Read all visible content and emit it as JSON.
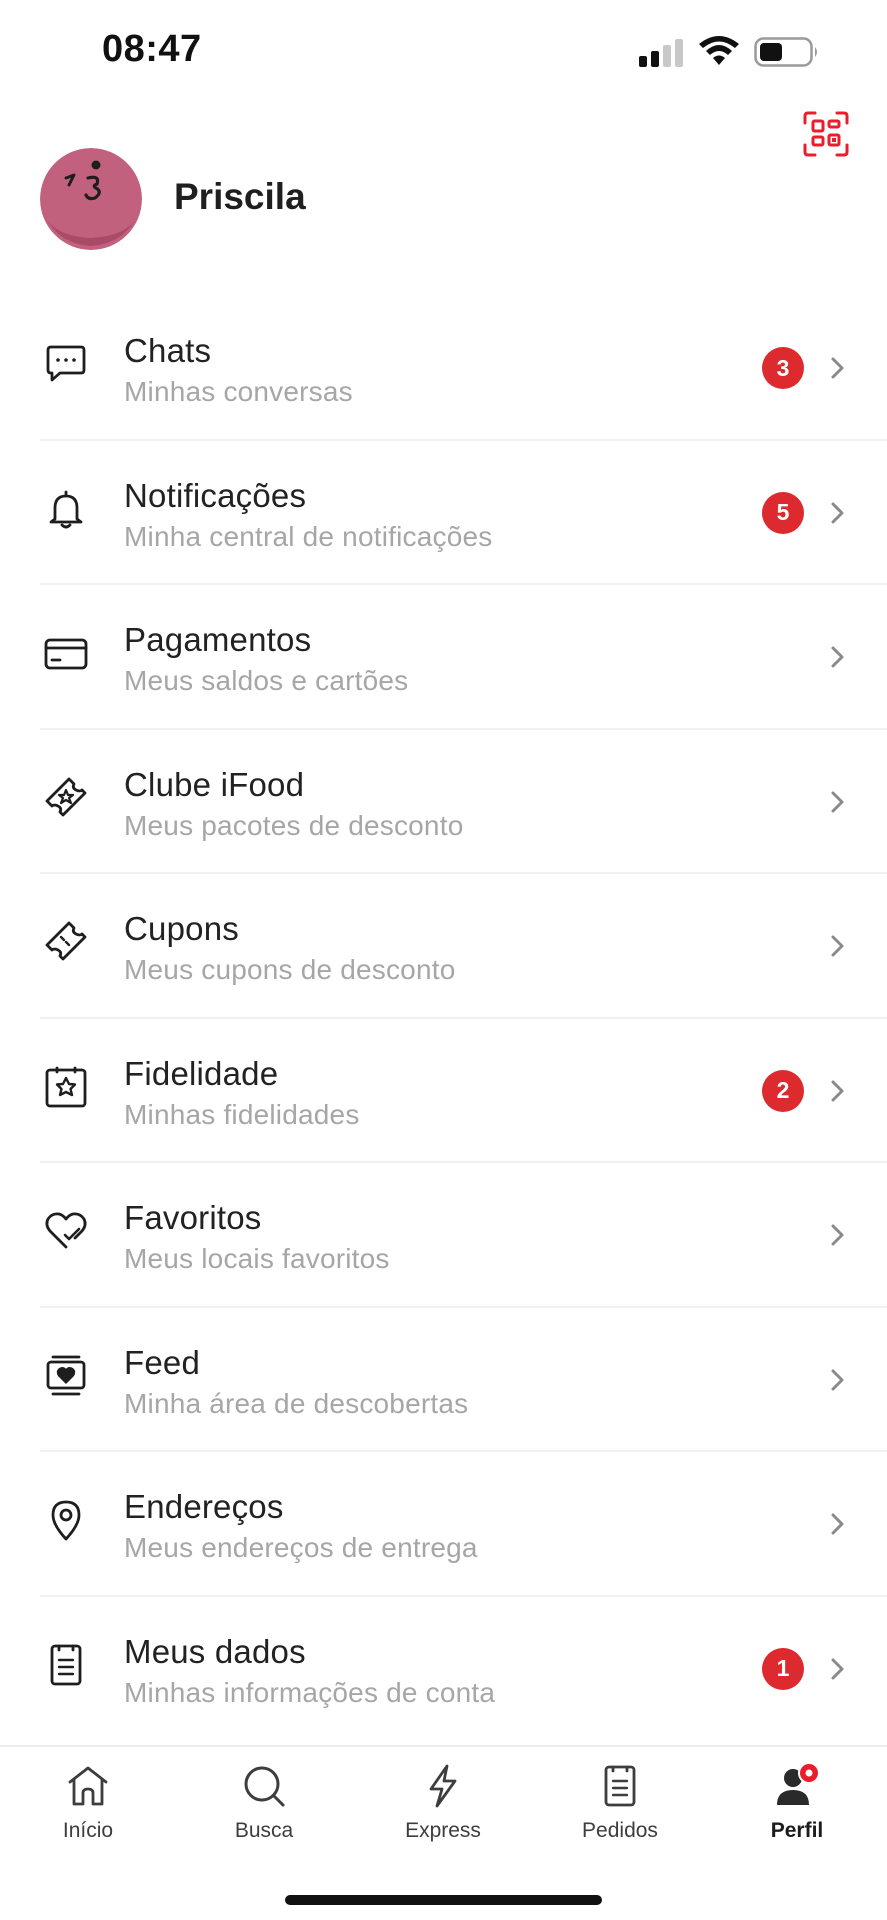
{
  "status_bar": {
    "time": "08:47",
    "icons": [
      "cellular-signal-icon",
      "wifi-icon",
      "battery-icon"
    ]
  },
  "header": {
    "qr_icon": "qr-code-scan-icon",
    "profile_name": "Priscila",
    "avatar_icon": "avatar-face-icon"
  },
  "colors": {
    "accent": "#ea1d2c",
    "badge": "#dc2a2e",
    "avatar": "#c2617e",
    "subtitle": "#a6a6a6"
  },
  "menu": {
    "items": [
      {
        "title": "Chats",
        "subtitle": "Minhas conversas",
        "icon": "chat-icon",
        "badge": "3"
      },
      {
        "title": "Notificações",
        "subtitle": "Minha central de notificações",
        "icon": "bell-icon",
        "badge": "5"
      },
      {
        "title": "Pagamentos",
        "subtitle": "Meus saldos e cartões",
        "icon": "credit-card-icon",
        "badge": null
      },
      {
        "title": "Clube iFood",
        "subtitle": "Meus pacotes de desconto",
        "icon": "ticket-star-icon",
        "badge": null
      },
      {
        "title": "Cupons",
        "subtitle": "Meus cupons de desconto",
        "icon": "coupon-icon",
        "badge": null
      },
      {
        "title": "Fidelidade",
        "subtitle": "Minhas fidelidades",
        "icon": "star-square-icon",
        "badge": "2"
      },
      {
        "title": "Favoritos",
        "subtitle": "Meus locais favoritos",
        "icon": "heart-icon",
        "badge": null
      },
      {
        "title": "Feed",
        "subtitle": "Minha área de descobertas",
        "icon": "feed-icon",
        "badge": null
      },
      {
        "title": "Endereços",
        "subtitle": "Meus endereços de entrega",
        "icon": "location-pin-icon",
        "badge": null
      },
      {
        "title": "Meus dados",
        "subtitle": "Minhas informações de conta",
        "icon": "document-icon",
        "badge": "1"
      }
    ]
  },
  "tab_bar": {
    "tabs": [
      {
        "label": "Início",
        "icon": "home-icon",
        "active": false
      },
      {
        "label": "Busca",
        "icon": "search-icon",
        "active": false
      },
      {
        "label": "Express",
        "icon": "lightning-icon",
        "active": false
      },
      {
        "label": "Pedidos",
        "icon": "orders-icon",
        "active": false
      },
      {
        "label": "Perfil",
        "icon": "profile-icon",
        "active": true
      }
    ]
  }
}
